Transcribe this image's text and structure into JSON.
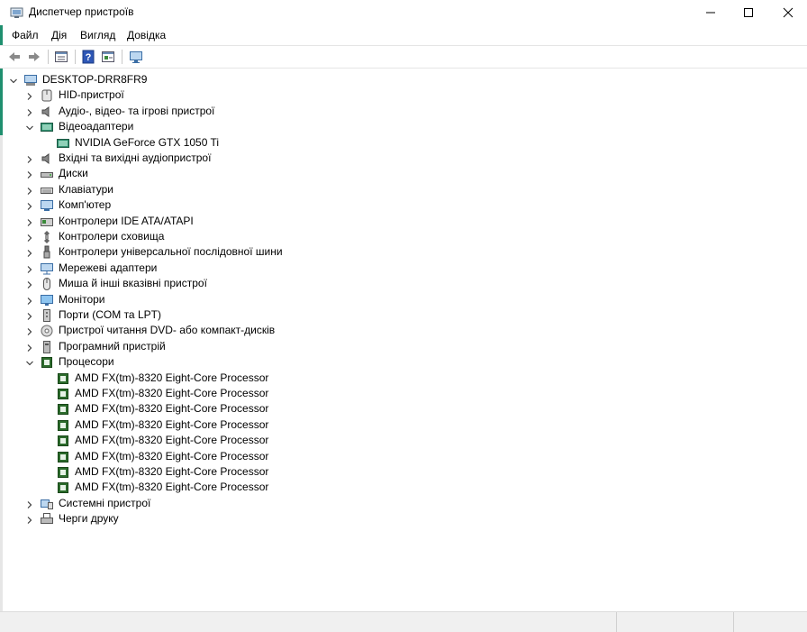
{
  "window": {
    "title": "Диспетчер пристроїв",
    "accent_color": "#1f8f6f"
  },
  "menu": [
    "Файл",
    "Дія",
    "Вигляд",
    "Довідка"
  ],
  "toolbar": {
    "buttons": [
      "back-icon",
      "forward-icon",
      "properties-icon",
      "help-icon",
      "update-driver-icon",
      "monitor-icon"
    ]
  },
  "tree": {
    "root": "DESKTOP-DRR8FR9",
    "categories": [
      {
        "label": "HID-пристрої",
        "icon": "hid-icon",
        "expanded": false
      },
      {
        "label": "Аудіо-, відео- та ігрові пристрої",
        "icon": "speaker-icon",
        "expanded": false
      },
      {
        "label": "Відеоадаптери",
        "icon": "display-adapter-icon",
        "expanded": true,
        "children": [
          "NVIDIA GeForce GTX 1050 Ti"
        ]
      },
      {
        "label": "Вхідні та вихідні аудіопристрої",
        "icon": "speaker-icon",
        "expanded": false
      },
      {
        "label": "Диски",
        "icon": "disk-icon",
        "expanded": false
      },
      {
        "label": "Клавіатури",
        "icon": "keyboard-icon",
        "expanded": false
      },
      {
        "label": "Комп'ютер",
        "icon": "computer-icon",
        "expanded": false
      },
      {
        "label": "Контролери IDE ATA/ATAPI",
        "icon": "ide-controller-icon",
        "expanded": false
      },
      {
        "label": "Контролери сховища",
        "icon": "storage-controller-icon",
        "expanded": false
      },
      {
        "label": "Контролери універсальної послідовної шини",
        "icon": "usb-icon",
        "expanded": false
      },
      {
        "label": "Мережеві адаптери",
        "icon": "network-icon",
        "expanded": false
      },
      {
        "label": "Миша й інші вказівні пристрої",
        "icon": "mouse-icon",
        "expanded": false
      },
      {
        "label": "Монітори",
        "icon": "monitor-icon",
        "expanded": false
      },
      {
        "label": "Порти (COM та LPT)",
        "icon": "port-icon",
        "expanded": false
      },
      {
        "label": "Пристрої читання DVD- або компакт-дисків",
        "icon": "dvd-icon",
        "expanded": false
      },
      {
        "label": "Програмний пристрій",
        "icon": "software-device-icon",
        "expanded": false
      },
      {
        "label": "Процесори",
        "icon": "processor-icon",
        "expanded": true,
        "children": [
          "AMD FX(tm)-8320 Eight-Core Processor",
          "AMD FX(tm)-8320 Eight-Core Processor",
          "AMD FX(tm)-8320 Eight-Core Processor",
          "AMD FX(tm)-8320 Eight-Core Processor",
          "AMD FX(tm)-8320 Eight-Core Processor",
          "AMD FX(tm)-8320 Eight-Core Processor",
          "AMD FX(tm)-8320 Eight-Core Processor",
          "AMD FX(tm)-8320 Eight-Core Processor"
        ]
      },
      {
        "label": "Системні пристрої",
        "icon": "system-device-icon",
        "expanded": false
      },
      {
        "label": "Черги друку",
        "icon": "printer-icon",
        "expanded": false
      }
    ]
  }
}
